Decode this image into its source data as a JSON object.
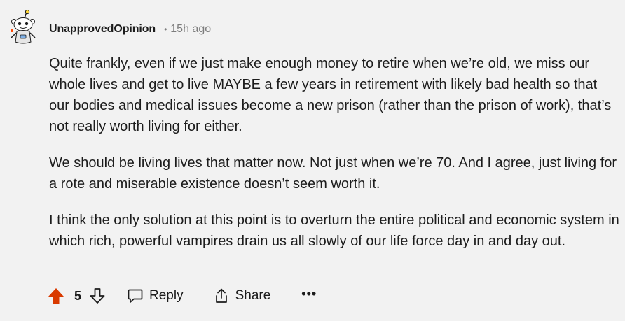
{
  "comment": {
    "username": "UnapprovedOpinion",
    "separator": "•",
    "timestamp": "15h ago",
    "paragraphs": [
      "Quite frankly, even if we just make enough money to retire when we’re old, we miss our whole lives and get to live MAYBE a few years in retirement with likely bad health so that our bodies and medical issues become a new prison (rather than the prison of work), that’s not really worth living for either.",
      "We should be living lives that matter now. Not just when we’re 70. And I agree, just living for a rote and miserable existence doesn’t seem worth it.",
      "I think the only solution at this point is to overturn the entire political and economic system in which rich, powerful vampires drain us all slowly of our life force day in and day out."
    ]
  },
  "actions": {
    "score": "5",
    "reply_label": "Reply",
    "share_label": "Share",
    "more_label": "•••"
  },
  "icons": {
    "upvote": "upvote-arrow-icon",
    "downvote": "downvote-arrow-icon",
    "reply": "speech-bubble-icon",
    "share": "share-icon",
    "avatar": "snoo-avatar-icon"
  },
  "colors": {
    "upvote_active": "#d93a00",
    "text": "#1c1c1c",
    "meta": "#7c7c7c",
    "background": "#f2f2f2"
  }
}
